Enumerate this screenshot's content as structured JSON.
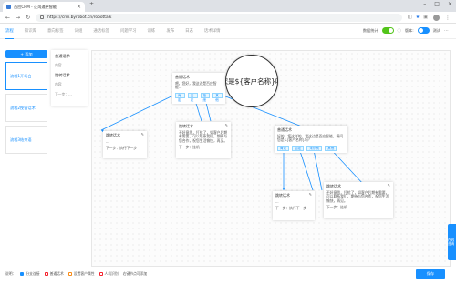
{
  "browser": {
    "tab_title": "百应CRM - 让沟通更智能",
    "url": "https://crm.byrobot.cn/robottalk"
  },
  "app_nav": {
    "items": [
      {
        "label": "流程"
      },
      {
        "label": "知识库"
      },
      {
        "label": "意向标签"
      },
      {
        "label": "词组"
      },
      {
        "label": "通话标签"
      },
      {
        "label": "问题学习"
      },
      {
        "label": "训练"
      },
      {
        "label": "发布"
      },
      {
        "label": "日志"
      },
      {
        "label": "话术详情"
      }
    ],
    "right": {
      "toggle1_label": "数据统计",
      "toggle2_label": "版本:",
      "toggle2_value": "测试"
    }
  },
  "left": {
    "add_button": "+ 添加",
    "flows": [
      {
        "label": "流程1开场白"
      },
      {
        "label": "流程2挽留话术"
      },
      {
        "label": "流程3结束语"
      }
    ]
  },
  "toolbox": {
    "items": [
      {
        "title": "普通话术",
        "sub": "内容"
      },
      {
        "title": "跳转话术",
        "sub": "内容"
      }
    ],
    "next_label": "下一步：..."
  },
  "canvas": {
    "magnifier_text": "您是${客户名称}吗",
    "nodes": [
      {
        "title": "普通话术",
        "text": "喂，您好，我这边是百应智能...",
        "chips": [
          "肯定",
          "否定",
          "拒绝",
          "其他"
        ]
      },
      {
        "title": "跳转话术",
        "text": "...",
        "next": "下一步：执行下一步"
      },
      {
        "title": "跳转话术",
        "text": "不好意思，打扰了，如客户后期有需要，可以联系我们，期待与您合作，祝您生活愉快，再见。",
        "next": "下一步：挂机"
      },
      {
        "title": "普通话术",
        "text": "好的，您这样的，我这边是百应智能，请问您是${客户名称}吗？",
        "chips": [
          "肯定",
          "否定",
          "未识别",
          "其他"
        ]
      },
      {
        "title": "跳转话术",
        "text": "...",
        "next": "下一步：执行下一步"
      },
      {
        "title": "跳转话术",
        "text": "不好意思，打扰了，如客户后期有需要，可以联系我们，期待与您合作，祝您生活愉快，再见。",
        "next": "下一步：挂机"
      }
    ]
  },
  "bottom": {
    "label": "说明：",
    "legend": [
      {
        "label": "分支连接"
      },
      {
        "label": "普通话术"
      },
      {
        "label": "设置客户属性"
      },
      {
        "label": "人机识别"
      },
      {
        "label": "右键节点可添加"
      }
    ],
    "save_button": "保存"
  },
  "side_tab": "在线咨询",
  "colors": {
    "accent": "#1890ff",
    "wire": "#1890ff",
    "toggle_on": "#52c41a"
  }
}
